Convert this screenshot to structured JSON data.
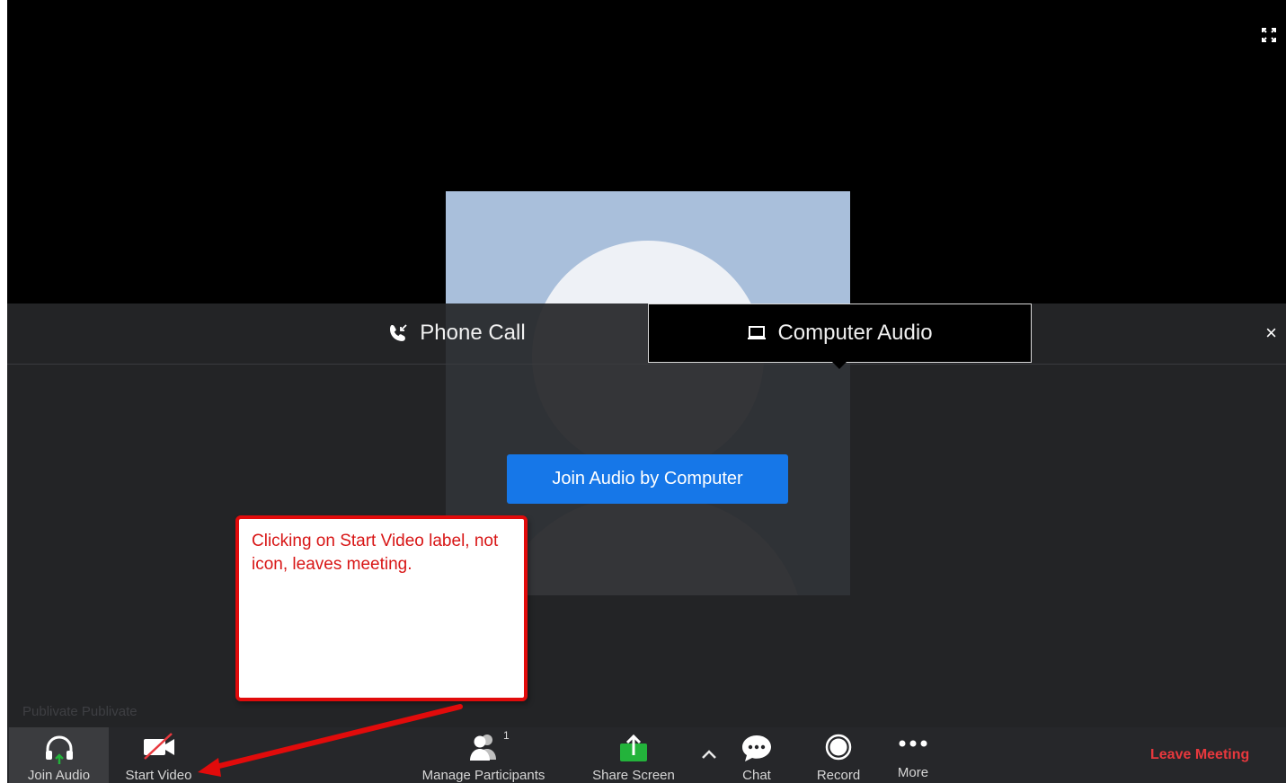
{
  "audio_panel": {
    "tabs": [
      {
        "label": "Phone Call",
        "icon": "phone-call-icon"
      },
      {
        "label": "Computer Audio",
        "icon": "laptop-icon",
        "selected": true
      }
    ],
    "join_button": "Join Audio by Computer",
    "close_symbol": "×"
  },
  "participant_name": "Publivate Publivate",
  "toolbar": {
    "join_audio": "Join Audio",
    "start_video": "Start Video",
    "manage_participants": "Manage Participants",
    "participants_count": "1",
    "share_screen": "Share Screen",
    "chat": "Chat",
    "record": "Record",
    "more": "More",
    "leave": "Leave Meeting"
  },
  "annotation": {
    "text": "Clicking on Start Video label, not icon, leaves meeting."
  },
  "colors": {
    "accent_blue": "#1677e8",
    "leave_red": "#e8383d",
    "share_green": "#23b33b",
    "annotation_red": "#e10b0b"
  }
}
